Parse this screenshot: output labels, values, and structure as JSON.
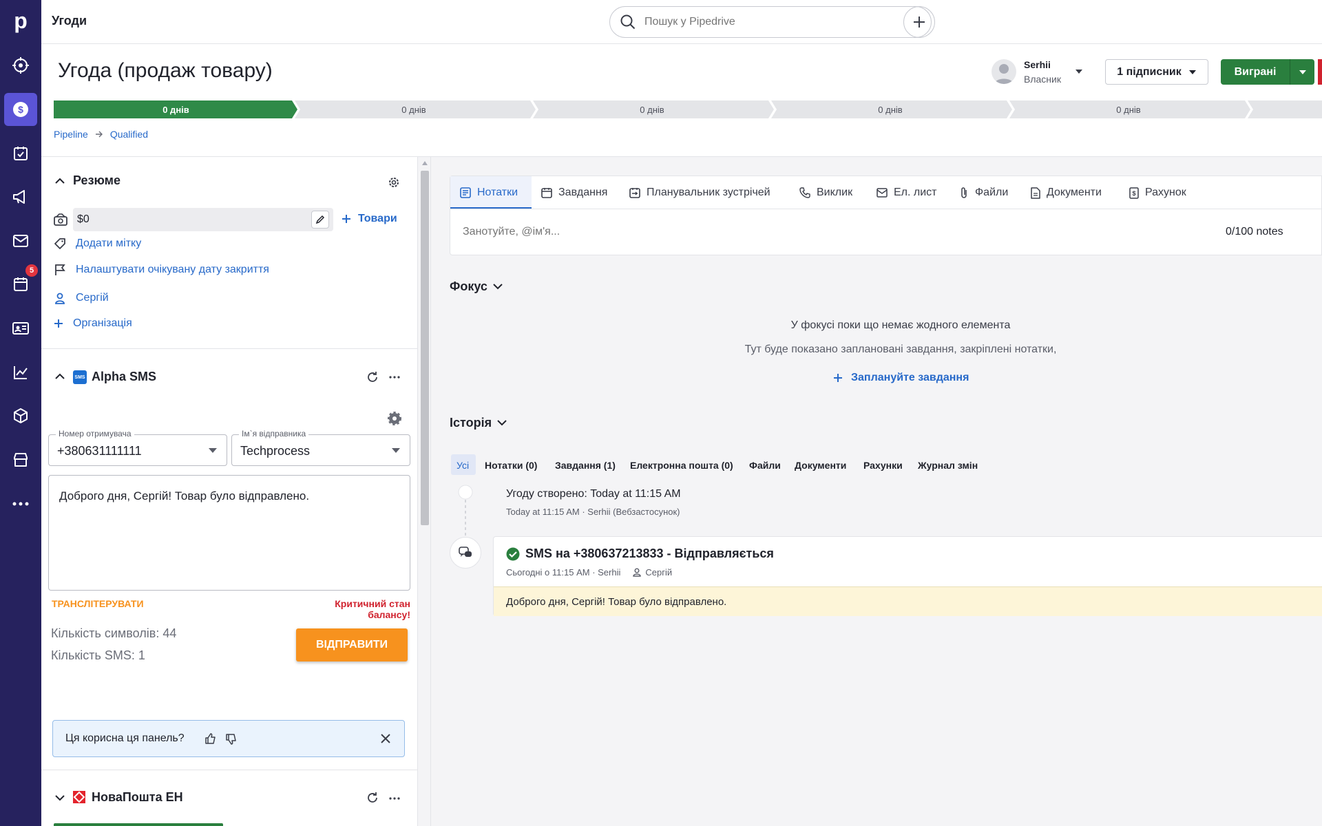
{
  "rail": {
    "logo": "p",
    "calendar_badge": "5",
    "icons": [
      "target-icon",
      "dollar-icon",
      "checkbox-icon",
      "megaphone-icon",
      "mail-icon",
      "calendar-icon",
      "contacts-icon",
      "chart-icon",
      "box-icon",
      "store-icon",
      "more-icon"
    ]
  },
  "topbar": {
    "title": "Угоди",
    "search_placeholder": "Пошук у Pipedrive"
  },
  "deal": {
    "title": "Угода (продаж товару)",
    "owner_name": "Serhii",
    "owner_role": "Власник",
    "followers": "1 підписник",
    "won_label": "Виграні",
    "stages": [
      "0 днів",
      "0 днів",
      "0 днів",
      "0 днів",
      "0 днів"
    ],
    "breadcrumb": [
      "Pipeline",
      "Qualified"
    ]
  },
  "summary": {
    "title": "Резюме",
    "value": "$0",
    "products_label": "Товари",
    "add_label": "Додати мітку",
    "close_date_label": "Налаштувати очікувану дату закриття",
    "person": "Сергій",
    "organization": "Організація"
  },
  "sms": {
    "title": "Alpha SMS",
    "recipient_label": "Номер отримувача",
    "recipient_value": "+380631111111",
    "sender_label": "Ім`я відправника",
    "sender_value": "Techprocess",
    "message": "Доброго дня, Сергій! Товар було відправлено.",
    "transliterate": "ТРАНСЛІТЕРУВАТИ",
    "balance_warning": "Критичний стан балансу!",
    "char_count": "Кількість символів: 44",
    "sms_count": "Кількість SMS: 1",
    "send_label": "ВІДПРАВИТИ"
  },
  "feedback": {
    "question": "Ця корисна ця панель?"
  },
  "nova": {
    "title": "НоваПошта ЕН"
  },
  "tabs": [
    "Нотатки",
    "Завдання",
    "Планувальник зустрічей",
    "Виклик",
    "Ел. лист",
    "Файли",
    "Документи",
    "Рахунок"
  ],
  "notes": {
    "placeholder": "Занотуйте, @ім'я...",
    "counter": "0/100 notes"
  },
  "focus": {
    "title": "Фокус",
    "empty_title": "У фокусі поки що немає жодного елемента",
    "empty_text": "Тут буде показано заплановані завдання, закріплені нотатки,",
    "schedule_label": "Заплануйте завдання"
  },
  "history": {
    "title": "Історія",
    "filters": [
      "Усі",
      "Нотатки (0)",
      "Завдання (1)",
      "Електронна пошта (0)",
      "Файли",
      "Документи",
      "Рахунки",
      "Журнал змін"
    ],
    "created_title": "Угоду створено",
    "created_time": "Today at 11:15 AM",
    "created_meta": "Today at 11:15 AM · Serhii (Вебзастосунок)",
    "sms_title": "SMS на +380637213833 - Відправляється",
    "sms_meta": "Сьогодні о 11:15 AM · Serhii",
    "sms_person": "Сергій",
    "sms_body": "Доброго дня, Сергій! Товар було відправлено."
  },
  "colors": {
    "rail": "#26225e",
    "rail_active": "#5b54d6",
    "stage_active": "#2f8a48",
    "won": "#2a7f3e",
    "send": "#f7921e",
    "link": "#2769c9",
    "warning": "#d0222e",
    "sms_body_bg": "#fdf5d8"
  }
}
